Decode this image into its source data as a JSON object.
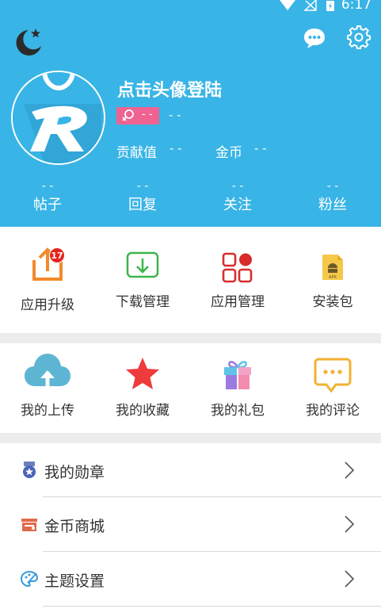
{
  "status_bar": {
    "time": "6:17"
  },
  "header": {
    "login_title": "点击头像登陆",
    "gender_badge_text": "- -",
    "level_text": "- -",
    "contribution_label": "贡献值",
    "contribution_value": "- -",
    "coins_label": "金币",
    "coins_value": "- -"
  },
  "counts": [
    {
      "value": "- -",
      "label": "帖子"
    },
    {
      "value": "- -",
      "label": "回复"
    },
    {
      "value": "- -",
      "label": "关注"
    },
    {
      "value": "- -",
      "label": "粉丝"
    }
  ],
  "grid1": [
    {
      "label": "应用升级",
      "icon": "upload-box-icon",
      "badge": "17"
    },
    {
      "label": "下载管理",
      "icon": "download-box-icon"
    },
    {
      "label": "应用管理",
      "icon": "app-grid-icon"
    },
    {
      "label": "安装包",
      "icon": "apk-file-icon"
    }
  ],
  "grid2": [
    {
      "label": "我的上传",
      "icon": "cloud-upload-icon"
    },
    {
      "label": "我的收藏",
      "icon": "star-icon"
    },
    {
      "label": "我的礼包",
      "icon": "gift-icon"
    },
    {
      "label": "我的评论",
      "icon": "comment-icon"
    }
  ],
  "list": [
    {
      "label": "我的勋章",
      "icon": "medal-icon"
    },
    {
      "label": "金币商城",
      "icon": "shop-icon"
    },
    {
      "label": "主题设置",
      "icon": "palette-icon"
    }
  ],
  "colors": {
    "header_bg": "#39b4e6",
    "badge_bg": "#e7231b",
    "gender_badge": "#ef6291",
    "separator": "#ececec"
  }
}
